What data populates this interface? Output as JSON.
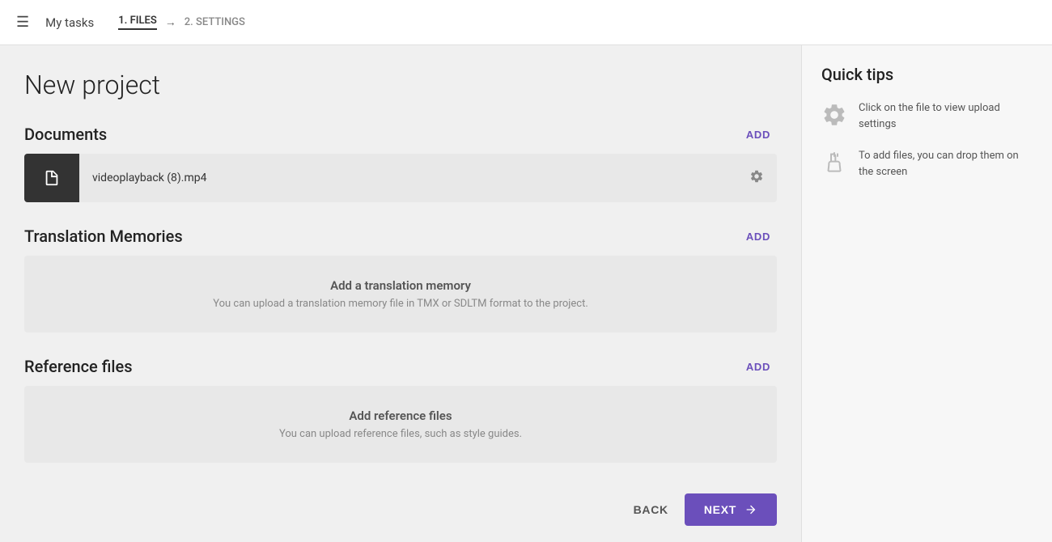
{
  "header": {
    "menu_icon": "☰",
    "my_tasks_label": "My tasks",
    "step1_label": "1. FILES",
    "arrow": "→",
    "step2_label": "2. SETTINGS"
  },
  "page": {
    "title": "New project"
  },
  "documents_section": {
    "title": "Documents",
    "add_label": "ADD",
    "file": {
      "name": "videoplayback (8).mp4"
    }
  },
  "translation_memories_section": {
    "title": "Translation Memories",
    "add_label": "ADD",
    "empty_title": "Add a translation memory",
    "empty_sub": "You can upload a translation memory file in TMX or SDLTM format to the project."
  },
  "reference_files_section": {
    "title": "Reference files",
    "add_label": "ADD",
    "empty_title": "Add reference files",
    "empty_sub": "You can upload reference files, such as style guides."
  },
  "footer": {
    "back_label": "BACK",
    "next_label": "NEXT"
  },
  "sidebar": {
    "title": "Quick tips",
    "tips": [
      {
        "icon": "gear",
        "text": "Click on the file to view upload settings"
      },
      {
        "icon": "hand",
        "text": "To add files, you can drop them on the screen"
      }
    ]
  },
  "colors": {
    "accent": "#6b4fbb"
  }
}
